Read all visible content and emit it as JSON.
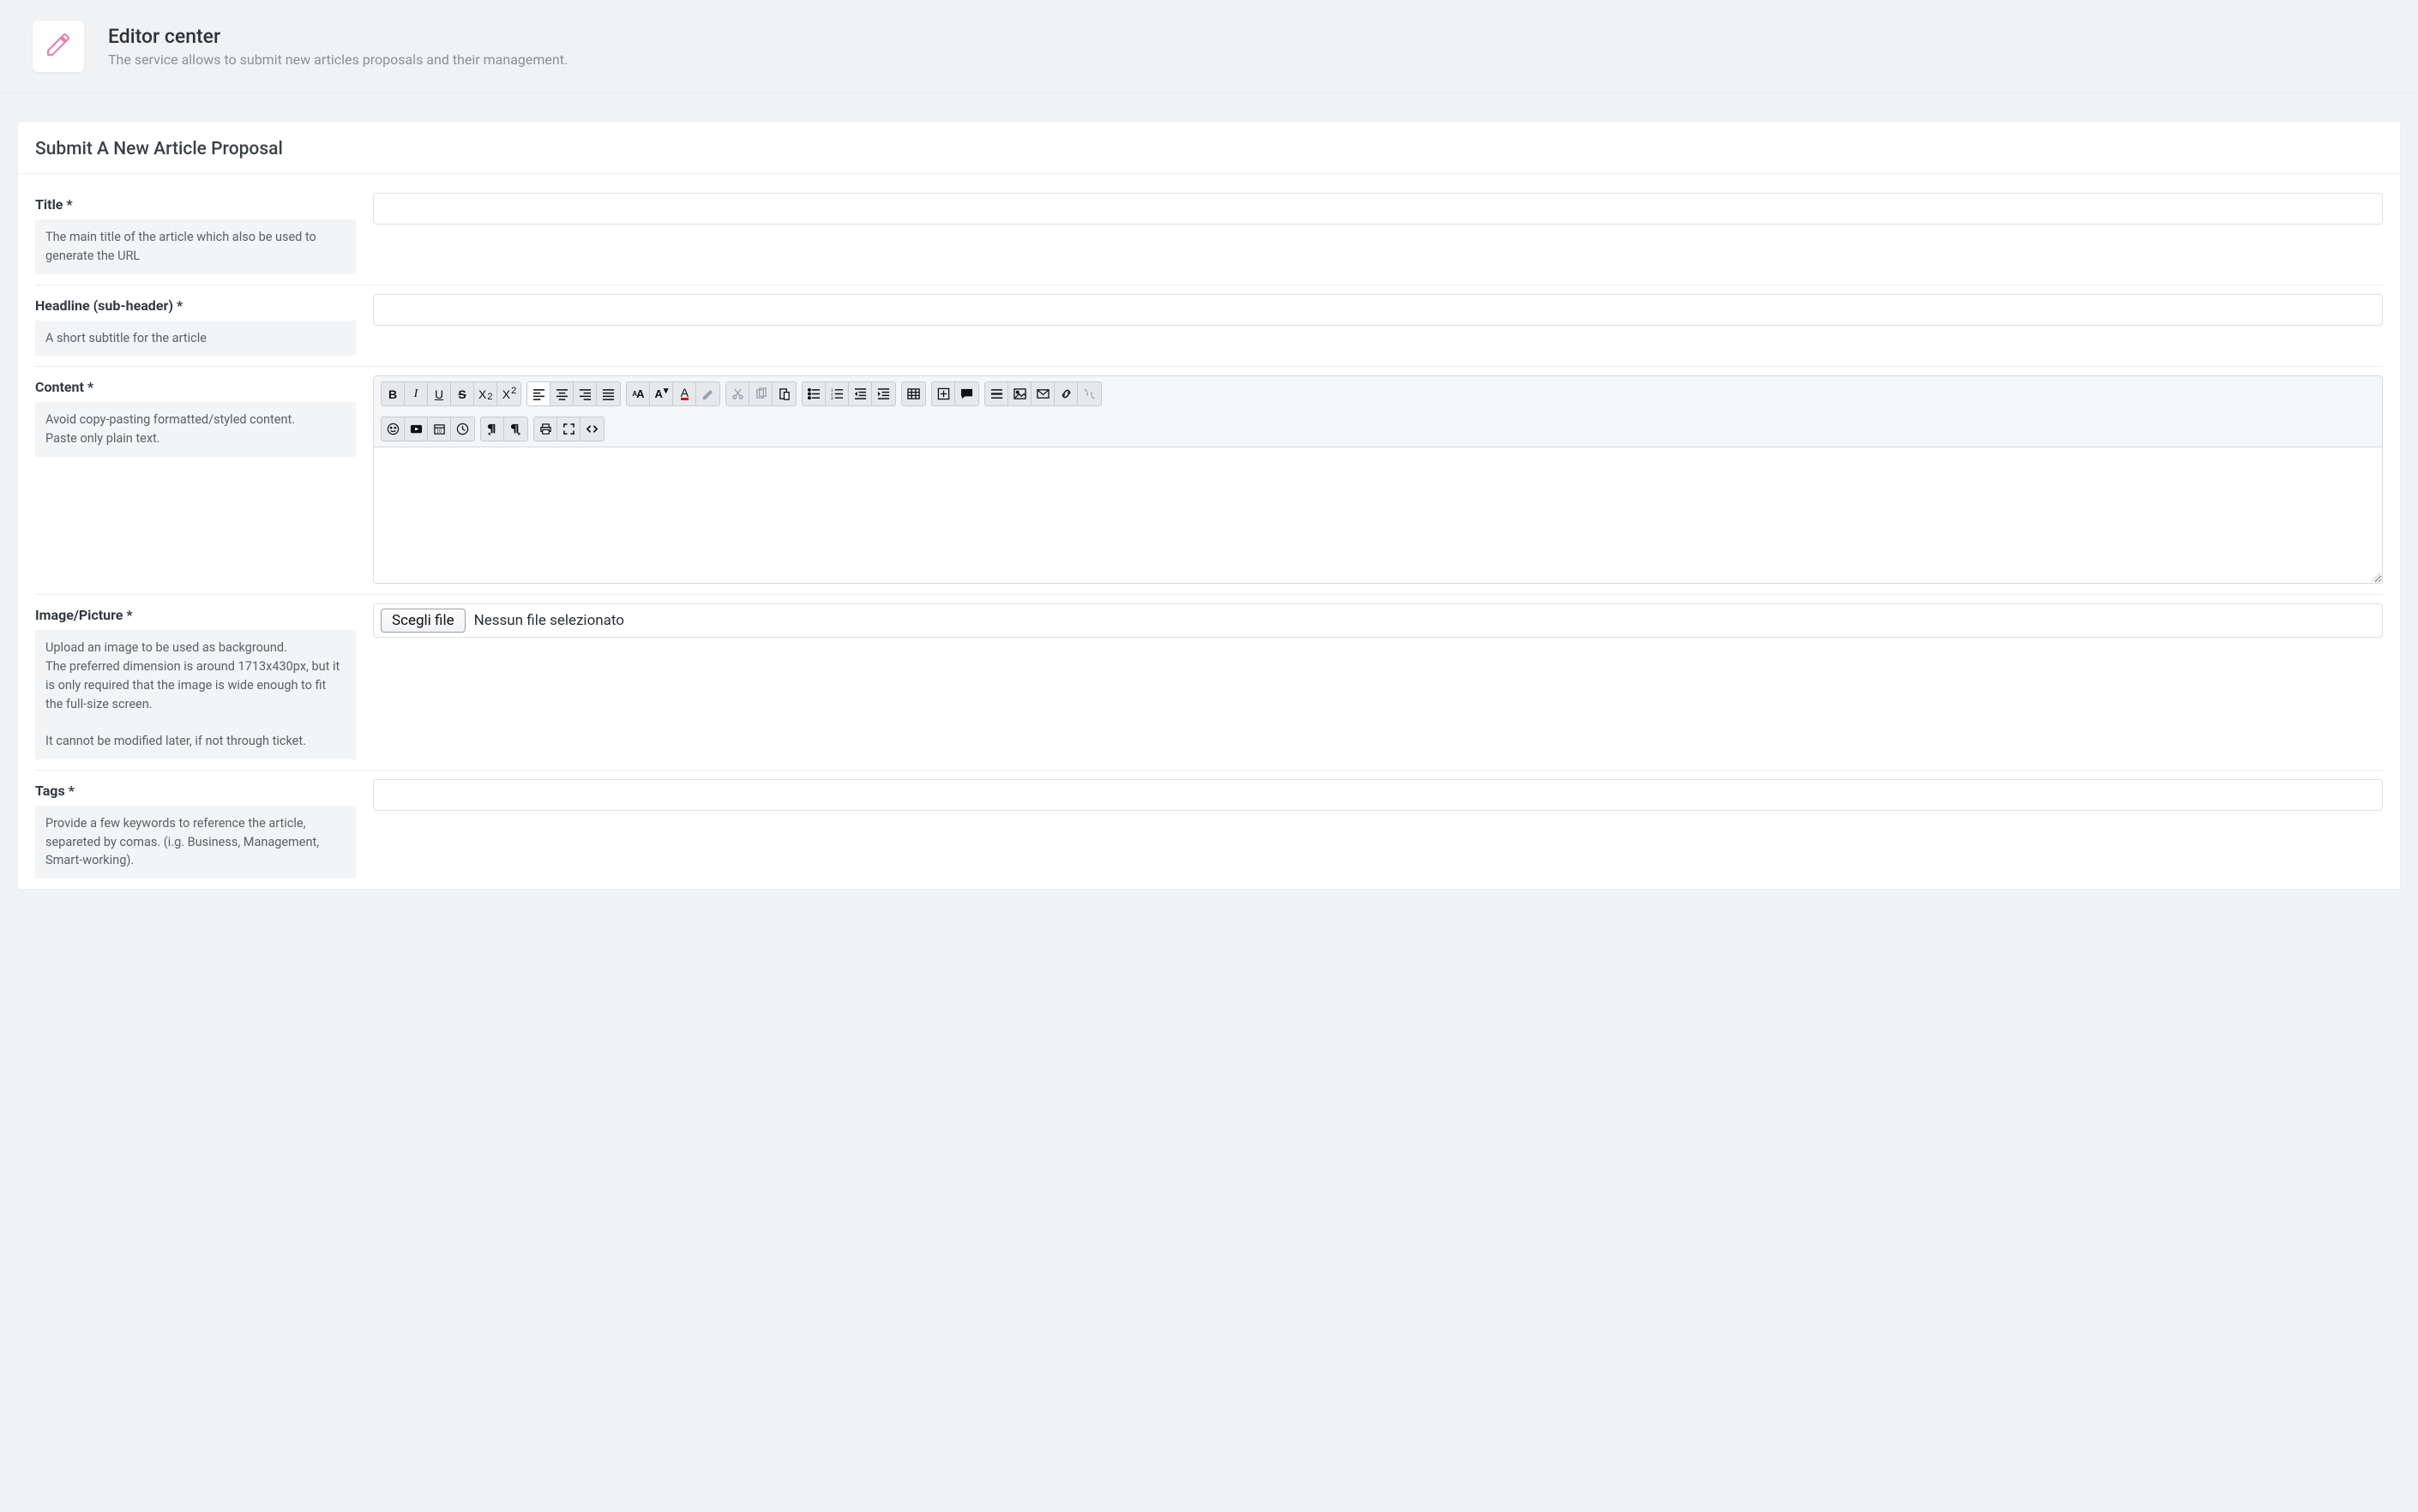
{
  "header": {
    "title": "Editor center",
    "subtitle": "The service allows to submit new articles proposals and their management."
  },
  "card": {
    "heading": "Submit A New Article Proposal"
  },
  "fields": {
    "title": {
      "label": "Title  *",
      "help": "The main title of the article which also be used to generate the URL",
      "value": ""
    },
    "headline": {
      "label": "Headline (sub-header) *",
      "help": "A short subtitle for the article",
      "value": ""
    },
    "content": {
      "label": "Content *",
      "help": "Avoid copy-pasting formatted/styled content.\nPaste only plain text.",
      "value": ""
    },
    "image": {
      "label": "Image/Picture *",
      "help": "Upload an image to be used as background.\nThe preferred dimension is around 1713x430px, but it is only required that the image is wide enough to fit the full-size screen.\n\nIt cannot be modified later, if not through ticket.",
      "button": "Scegli file",
      "none": "Nessun file selezionato"
    },
    "tags": {
      "label": "Tags *",
      "help": "Provide a few keywords to reference the article, separeted by comas. (i.g. Business, Management, Smart-working).",
      "value": ""
    }
  }
}
